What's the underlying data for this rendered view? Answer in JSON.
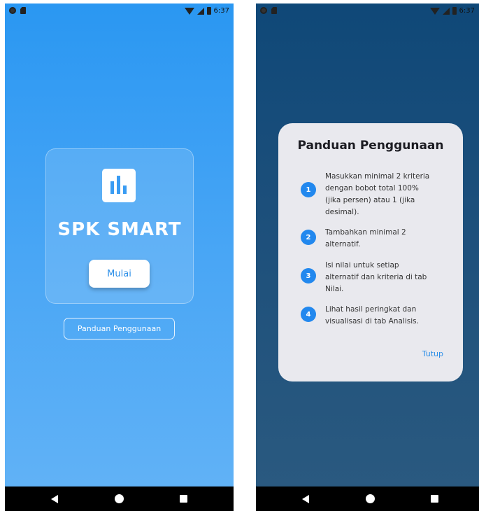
{
  "status": {
    "time": "6:37"
  },
  "home": {
    "app_title": "SPK SMART",
    "start_label": "Mulai",
    "guide_label": "Panduan Penggunaan"
  },
  "guide_dialog": {
    "title": "Panduan Penggunaan",
    "steps": [
      {
        "num": "1",
        "text": "Masukkan minimal 2 kriteria dengan bobot total 100% (jika persen) atau 1 (jika desimal)."
      },
      {
        "num": "2",
        "text": "Tambahkan minimal 2 alternatif."
      },
      {
        "num": "3",
        "text": "Isi nilai untuk setiap alternatif dan kriteria di tab Nilai."
      },
      {
        "num": "4",
        "text": "Lihat hasil peringkat dan visualisasi di tab Analisis."
      }
    ],
    "close_label": "Tutup"
  },
  "colors": {
    "primary": "#2a97f2",
    "accent_text": "#2a8ee8",
    "dialog_bg": "#e9e9ee"
  },
  "icons": [
    "chart-icon",
    "back-icon",
    "home-icon",
    "recent-apps-icon",
    "wifi-icon",
    "signal-icon",
    "battery-icon"
  ]
}
